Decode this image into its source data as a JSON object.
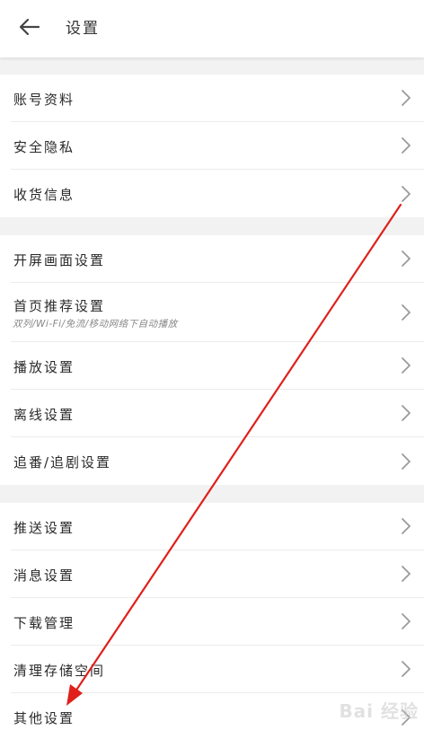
{
  "header": {
    "title": "设置",
    "back_icon": "arrow-left-icon"
  },
  "groups": [
    {
      "items": [
        {
          "label": "账号资料"
        },
        {
          "label": "安全隐私"
        },
        {
          "label": "收货信息"
        }
      ]
    },
    {
      "items": [
        {
          "label": "开屏画面设置"
        },
        {
          "label": "首页推荐设置",
          "subtitle": "双列/Wi-Fi/免流/移动网络下自动播放"
        },
        {
          "label": "播放设置"
        },
        {
          "label": "离线设置"
        },
        {
          "label": "追番/追剧设置"
        }
      ]
    },
    {
      "items": [
        {
          "label": "推送设置"
        },
        {
          "label": "消息设置"
        },
        {
          "label": "下载管理"
        },
        {
          "label": "清理存储空间"
        },
        {
          "label": "其他设置"
        }
      ]
    }
  ],
  "annotation": {
    "color": "#e0201b",
    "icon": "red-arrow"
  },
  "watermark": {
    "text": "Bai 经验"
  },
  "colors": {
    "background": "#f2f2f2",
    "row_background": "#ffffff",
    "divider": "#ececec",
    "chevron": "#9a9a9a"
  }
}
